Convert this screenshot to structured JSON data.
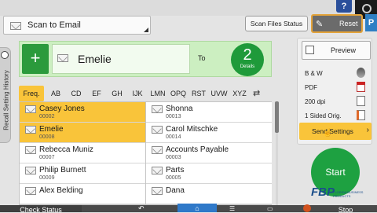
{
  "header": {
    "title": "Scan to Email",
    "help_label": "?",
    "scan_files_status": "Scan Files Status",
    "reset_label": "Reset",
    "preview_icon_label": "P"
  },
  "side_tab": {
    "label": "Recall Setting History"
  },
  "destination": {
    "add_label": "+",
    "name": "Emelie",
    "to_label": "To",
    "count": "2",
    "count_label": "Details"
  },
  "tabs": [
    {
      "label": "Freq.",
      "active": true
    },
    {
      "label": "AB"
    },
    {
      "label": "CD"
    },
    {
      "label": "EF"
    },
    {
      "label": "GH"
    },
    {
      "label": "IJK"
    },
    {
      "label": "LMN"
    },
    {
      "label": "OPQ"
    },
    {
      "label": "RST"
    },
    {
      "label": "UVW"
    },
    {
      "label": "XYZ"
    }
  ],
  "sort_icon": "⇄",
  "address_list": {
    "left": [
      {
        "name": "Casey Jones",
        "number": "00002",
        "selected": true
      },
      {
        "name": "Emelie",
        "number": "00008",
        "selected": true
      },
      {
        "name": "Rebecca Muniz",
        "number": "00007"
      },
      {
        "name": "Philip Burnett",
        "number": "00009"
      },
      {
        "name": "Alex Belding",
        "number": ""
      }
    ],
    "right": [
      {
        "name": "Shonna",
        "number": "00013"
      },
      {
        "name": "Carol Mitschke",
        "number": "00014"
      },
      {
        "name": "Accounts Payable",
        "number": "00003"
      },
      {
        "name": "Parts",
        "number": "00005"
      },
      {
        "name": "Dana",
        "number": ""
      }
    ]
  },
  "settings": {
    "preview_label": "Preview",
    "rows": [
      {
        "label": "B & W",
        "icon": "bw-icon"
      },
      {
        "label": "PDF",
        "icon": "pdf-icon"
      },
      {
        "label": "200 dpi",
        "icon": "resolution-icon"
      },
      {
        "label": "1 Sided Orig.",
        "icon": "page-icon"
      }
    ],
    "send_settings_label": "Send Settings",
    "start_label": "Start"
  },
  "logo": {
    "text": "FBP",
    "sub": "FLORIDA BUSINESS PRODUCTS"
  },
  "bottom_bar": {
    "check_status": "Check Status",
    "stop_label": "Stop"
  },
  "colors": {
    "accent_yellow": "#f9c43a",
    "green": "#1ea141",
    "dest_panel": "#ccefc1",
    "reset_border": "#e3a33a",
    "home_blue": "#2f79c9"
  }
}
